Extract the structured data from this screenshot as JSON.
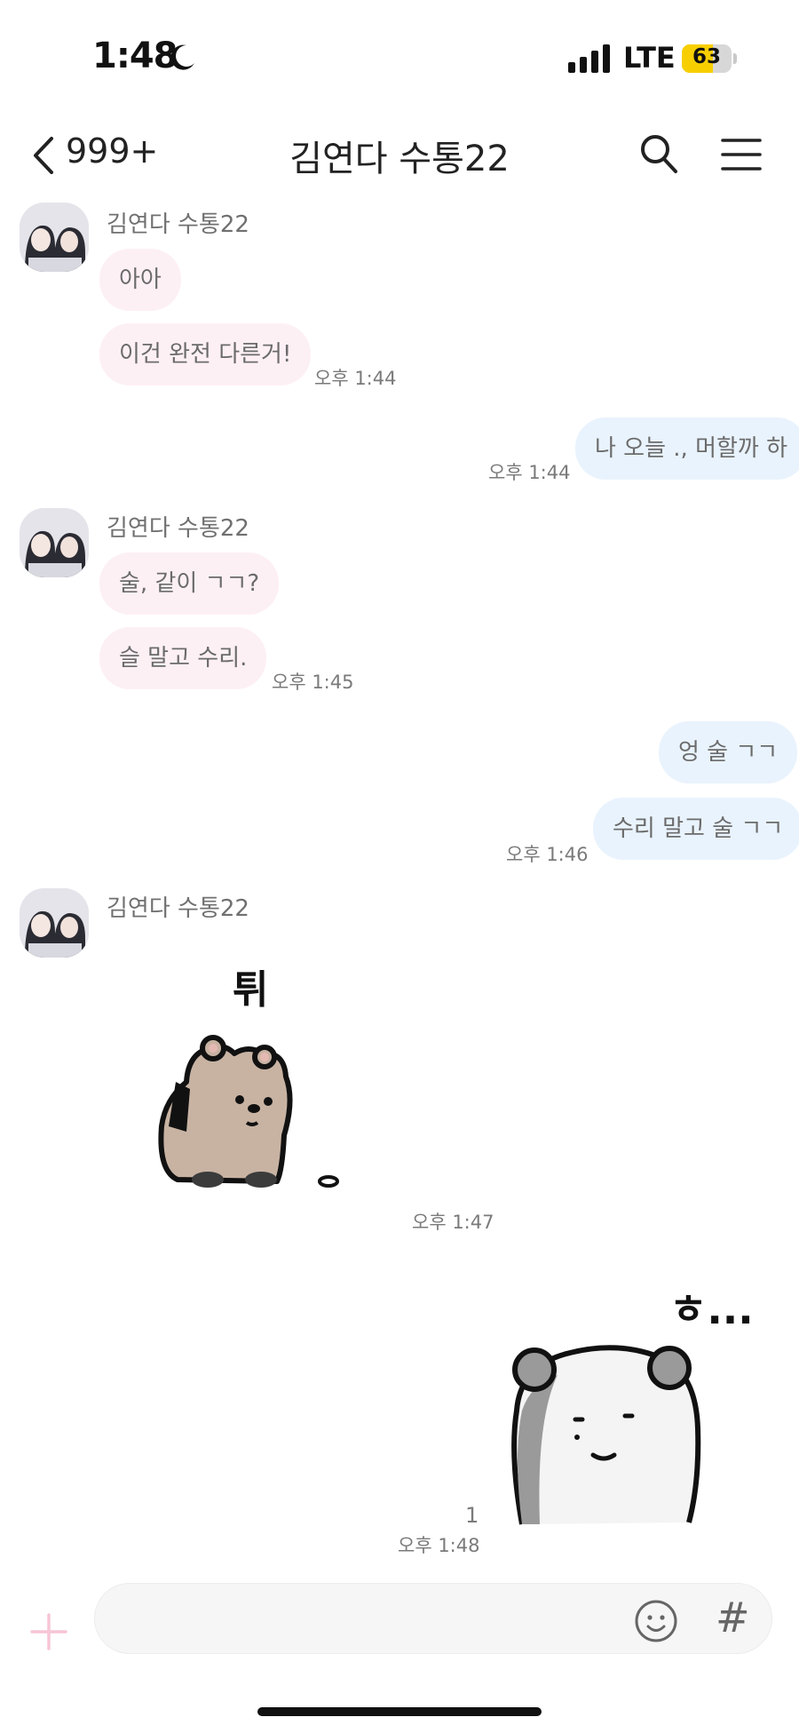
{
  "status_bar": {
    "time": "1:48",
    "network": "LTE",
    "battery": "63",
    "battery_level": 0.63,
    "battery_color": "#f7cf00"
  },
  "header": {
    "back_count": "999+",
    "title": "김연다 수통22"
  },
  "messages": {
    "group1": {
      "sender": "김연다 수통22",
      "m1": "아아",
      "m2": "이건 완전 다른거!",
      "time": "오후 1:44"
    },
    "out1": {
      "m1": "나 오늘 ., 머할까 하",
      "time": "오후 1:44"
    },
    "group2": {
      "sender": "김연다 수통22",
      "m1": "술, 같이 ㄱㄱ?",
      "m2": "슬 말고 수리.",
      "time": "오후 1:45"
    },
    "out2": {
      "m1": "엉 술 ㄱㄱ",
      "m2": "수리 말고 술 ㄱㄱ",
      "time": "오후 1:46"
    },
    "group3": {
      "sender": "김연다 수통22",
      "sticker_text": "튀",
      "time": "오후 1:47"
    },
    "out3": {
      "sticker_text": "ㅎ...",
      "unread": "1",
      "time": "오후 1:48"
    }
  },
  "colors": {
    "incoming_bubble": "#fdf0f5",
    "outgoing_bubble": "#e9f3fd"
  },
  "input": {
    "placeholder": ""
  }
}
